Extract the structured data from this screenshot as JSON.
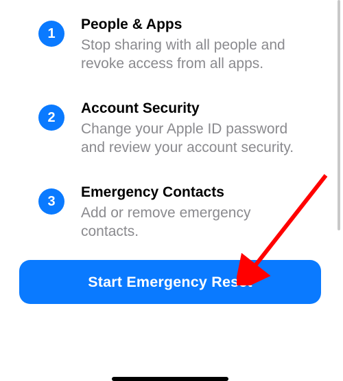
{
  "colors": {
    "accent": "#0a7aff",
    "muted_text": "#8a8a8e",
    "arrow": "#ff0000"
  },
  "steps": [
    {
      "num": "1",
      "title": "People & Apps",
      "desc": "Stop sharing with all people and revoke access from all apps."
    },
    {
      "num": "2",
      "title": "Account Security",
      "desc": "Change your Apple ID password and review your account security."
    },
    {
      "num": "3",
      "title": "Emergency Contacts",
      "desc": "Add or remove emergency contacts."
    }
  ],
  "cta": {
    "label": "Start Emergency Reset"
  }
}
